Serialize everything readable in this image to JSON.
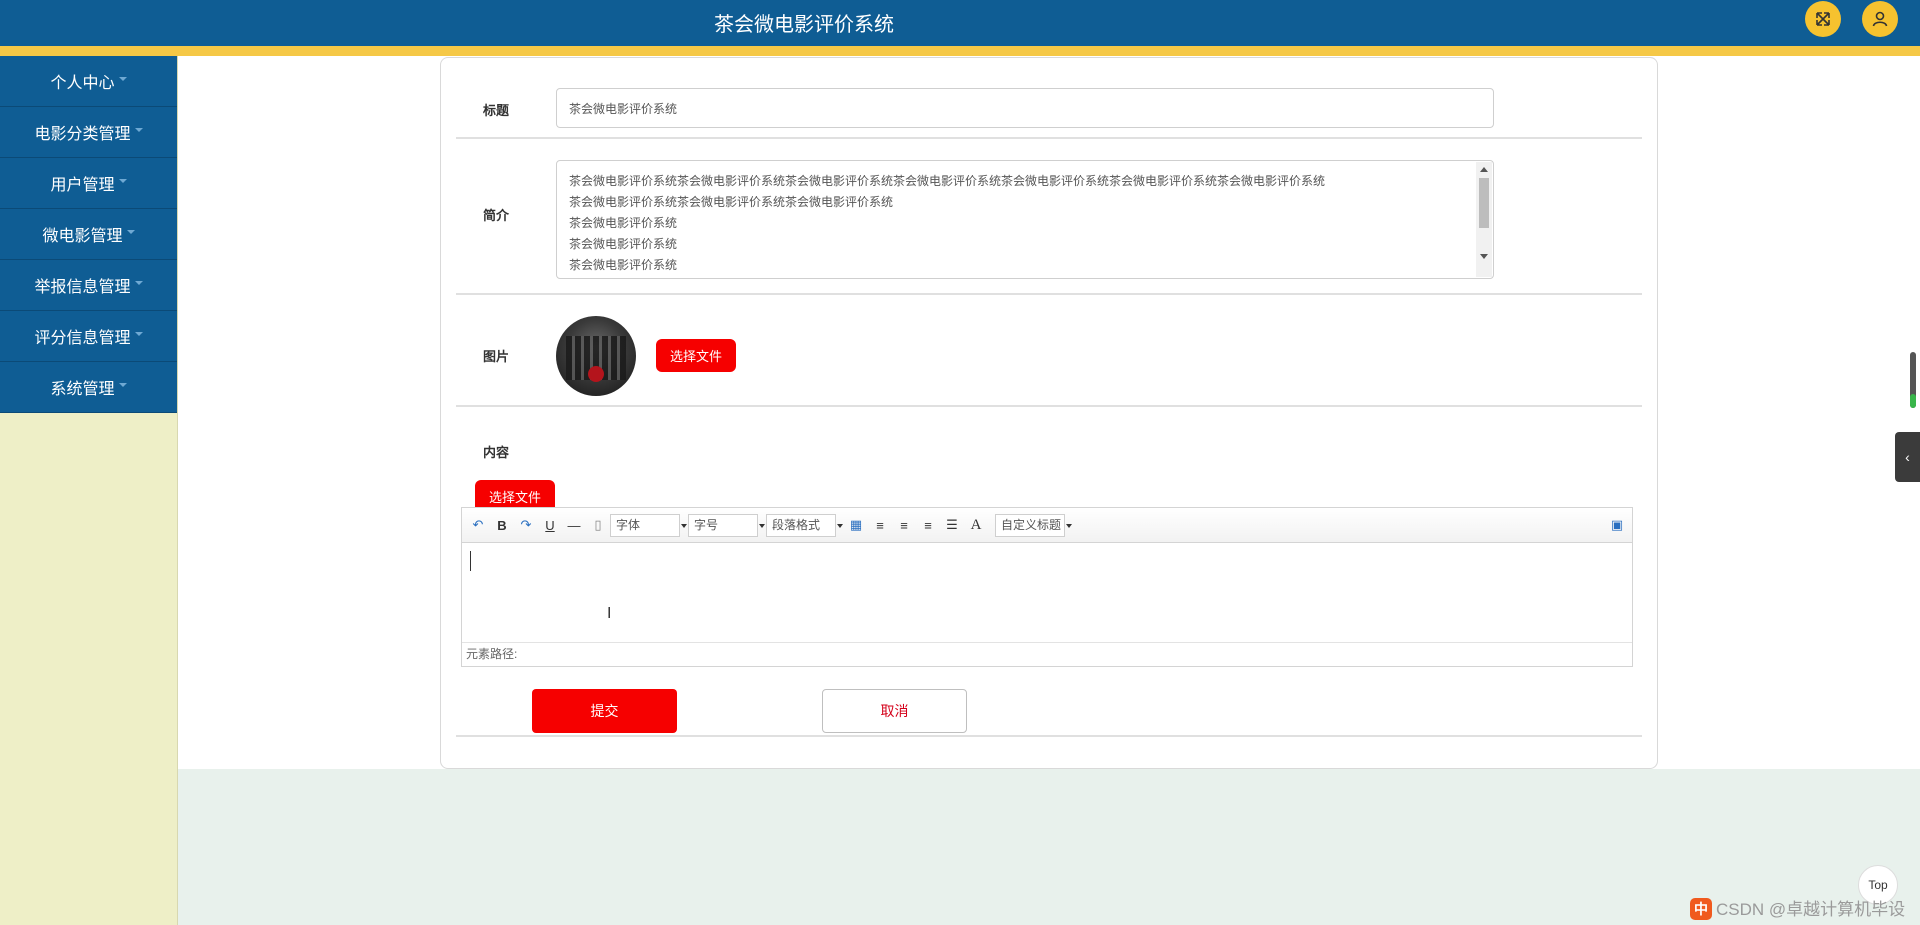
{
  "header": {
    "title": "茶会微电影评价系统",
    "fullscreen_icon": "expand-icon",
    "user_icon": "user-icon",
    "bg_color": "#0f5d94",
    "stripe_color": "#f5c846"
  },
  "sidebar": {
    "items": [
      {
        "label": "个人中心"
      },
      {
        "label": "电影分类管理"
      },
      {
        "label": "用户管理"
      },
      {
        "label": "微电影管理"
      },
      {
        "label": "举报信息管理"
      },
      {
        "label": "评分信息管理"
      },
      {
        "label": "系统管理"
      }
    ]
  },
  "form": {
    "title_label": "标题",
    "title_value": "茶会微电影评价系统",
    "intro_label": "简介",
    "intro_lines": [
      "茶会微电影评价系统茶会微电影评价系统茶会微电影评价系统茶会微电影评价系统茶会微电影评价系统茶会微电影评价系统茶会微电影评价系统",
      "茶会微电影评价系统茶会微电影评价系统茶会微电影评价系统",
      "茶会微电影评价系统",
      "茶会微电影评价系统",
      "茶会微电影评价系统"
    ],
    "image_label": "图片",
    "choose_file_label": "选择文件",
    "content_label": "内容",
    "content_choose_file_label": "选择文件",
    "submit_label": "提交",
    "cancel_label": "取消"
  },
  "editor": {
    "font_select": "字体",
    "size_select": "字号",
    "paragraph_select": "段落格式",
    "custom_title_select": "自定义标题",
    "path_label": "元素路径:",
    "toolbar_icons": [
      "undo-icon",
      "bold-icon",
      "redo-icon",
      "underline-icon",
      "horizontal-rule-icon",
      "paste-icon",
      "table-icon",
      "align-left-icon",
      "align-right-icon",
      "align-center-icon",
      "align-justify-icon",
      "font-color-icon",
      "preview-icon"
    ]
  },
  "widgets": {
    "top_label": "Top",
    "watermark": "CSDN @卓越计算机毕设",
    "ime_label": "中",
    "side_tab_icon": "chevron-left-icon"
  },
  "colors": {
    "accent": "#f60000",
    "sidebar_bg": "#eeefc7",
    "page_bg": "#e8f1ec"
  }
}
